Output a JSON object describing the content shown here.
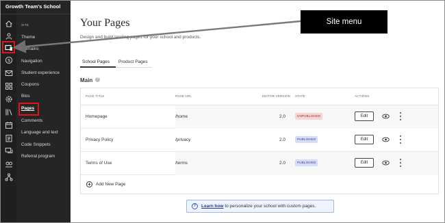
{
  "brand": "Growth Team's School",
  "sidebar": {
    "section_label": "SITE",
    "items": [
      {
        "label": "Theme",
        "active": false
      },
      {
        "label": "Domains",
        "active": false
      },
      {
        "label": "Navigation",
        "active": false
      },
      {
        "label": "Student experience",
        "active": false
      },
      {
        "label": "Coupons",
        "active": false
      },
      {
        "label": "Bios",
        "active": false
      },
      {
        "label": "Pages",
        "active": true
      },
      {
        "label": "Comments",
        "active": false
      },
      {
        "label": "Language and text",
        "active": false
      },
      {
        "label": "Code Snippets",
        "active": false
      },
      {
        "label": "Referral program",
        "active": false
      }
    ]
  },
  "rail_icons": [
    "home-icon",
    "users-icon",
    "site-icon",
    "dollar-icon",
    "mail-icon",
    "grid-icon",
    "gear-icon",
    "library-icon",
    "calendar-icon",
    "clipboard-icon",
    "chat-icon",
    "people-icon",
    "network-icon"
  ],
  "main": {
    "title": "Your Pages",
    "subtitle": "Design and build landing pages for your school and products.",
    "tabs": [
      {
        "label": "School Pages",
        "active": true
      },
      {
        "label": "Product Pages",
        "active": false
      }
    ],
    "section_title": "Main",
    "table": {
      "headers": {
        "title": "PAGE TITLE",
        "url": "PAGE URL",
        "version": "EDITOR VERSION",
        "state": "STATE",
        "actions": "ACTIONS"
      },
      "rows": [
        {
          "title": "Homepage",
          "url": "/home",
          "version": "2.0",
          "state": "UNPUBLISHED",
          "edit": "Edit"
        },
        {
          "title": "Privacy Policy",
          "url": "/privacy",
          "version": "2.0",
          "state": "PUBLISHED",
          "edit": "Edit"
        },
        {
          "title": "Terms of Use",
          "url": "/terms",
          "version": "2.0",
          "state": "PUBLISHED",
          "edit": "Edit"
        }
      ],
      "add_label": "Add New Page"
    },
    "notice": {
      "link": "Learn how",
      "text": " to personalize your school with custom pages."
    }
  },
  "callout": {
    "label": "Site menu"
  },
  "colors": {
    "highlight": "#e3131b",
    "rail_bg": "#1f1f1f",
    "sidebar_bg": "#252525",
    "unpublished_bg": "#f6d5d6",
    "published_bg": "#d4dcf7",
    "notice_border": "#9fb6e8"
  }
}
